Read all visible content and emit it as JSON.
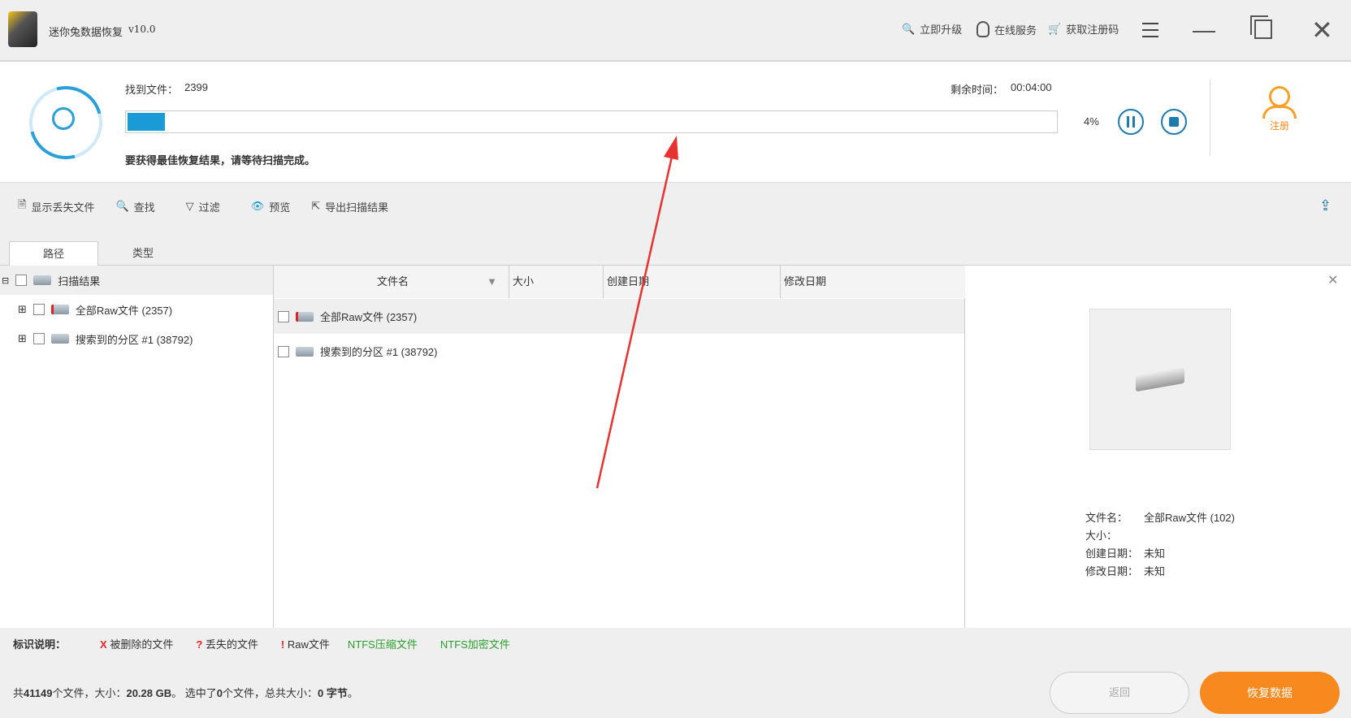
{
  "app": {
    "title": "迷你兔数据恢复",
    "version": "v10.0"
  },
  "header_actions": [
    {
      "label": "立即升级",
      "icon": "upgrade-search-icon"
    },
    {
      "label": "在线服务",
      "icon": "chat-icon"
    },
    {
      "label": "获取注册码",
      "icon": "cart-icon"
    }
  ],
  "scan": {
    "found_label": "找到文件：",
    "found_count": "2399",
    "remaining_label": "剩余时间：",
    "remaining_time": "00:04:00",
    "progress_percent": 4,
    "progress_text": "4%",
    "hint": "要获得最佳恢复结果，请等待扫描完成。",
    "register_label": "注册"
  },
  "toolbar": {
    "items": [
      "显示丢失文件",
      "查找",
      "过滤",
      "预览",
      "导出扫描结果"
    ]
  },
  "tabs": [
    "路径",
    "类型"
  ],
  "tree": {
    "root": "扫描结果",
    "children": [
      "全部Raw文件 (2357)",
      "搜索到的分区 #1 (38792)"
    ]
  },
  "table": {
    "columns": [
      "文件名",
      "大小",
      "创建日期",
      "修改日期"
    ],
    "rows": [
      {
        "name": "全部Raw文件 (2357)"
      },
      {
        "name": "搜索到的分区 #1 (38792)"
      }
    ]
  },
  "preview": {
    "labels": [
      "文件名：",
      "大小：",
      "创建日期：",
      "修改日期："
    ],
    "values": [
      "全部Raw文件 (102)",
      "",
      "未知",
      "未知"
    ]
  },
  "legend": {
    "title": "标识说明：",
    "items": [
      {
        "mark": "X",
        "label": "被删除的文件"
      },
      {
        "mark": "?",
        "label": "丢失的文件"
      },
      {
        "mark": "!",
        "label": "Raw文件"
      },
      {
        "label": "NTFS压缩文件"
      },
      {
        "label": "NTFS加密文件"
      }
    ]
  },
  "summary": {
    "p1": "共",
    "total_files": "41149",
    "p2": "个文件，大小：",
    "total_size": "20.28 GB",
    "p3": "。 选中了",
    "selected": "0",
    "p4": "个文件，总共大小：",
    "selected_size": "0 字节",
    "p5": "。"
  },
  "buttons": {
    "back": "返回",
    "recover": "恢复数据"
  },
  "colors": {
    "accent": "#1a9ad6",
    "orange": "#f7891e",
    "green": "#2aa02a"
  }
}
